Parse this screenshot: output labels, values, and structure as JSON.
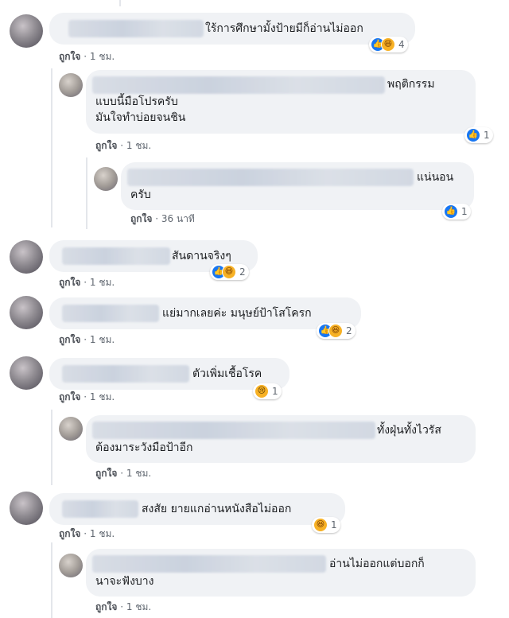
{
  "comments": [
    {
      "text": "ใร้การศึกษามั้งป้ายมีก็อ่านไม่ออก",
      "like": "ถูกใจ",
      "dot": "·",
      "time": "1 ชม.",
      "reaction_count": "4",
      "reactions": [
        "like-icon",
        "haha-icon"
      ]
    },
    {
      "text_lines": [
        "พฤติกรรม",
        "แบบนี้มือโปรครับ",
        "มันใจทำบ่อยจนชิน"
      ],
      "like": "ถูกใจ",
      "dot": "·",
      "time": "1 ชม.",
      "reaction_count": "1",
      "reactions": [
        "like-icon"
      ]
    },
    {
      "text_lines": [
        "แน่นอน",
        "ครับ"
      ],
      "like": "ถูกใจ",
      "dot": "·",
      "time": "36 นาที",
      "reaction_count": "1",
      "reactions": [
        "like-icon"
      ]
    },
    {
      "text": "สันดานจริงๆ",
      "like": "ถูกใจ",
      "dot": "·",
      "time": "1 ชม.",
      "reaction_count": "2",
      "reactions": [
        "like-icon",
        "haha-icon"
      ]
    },
    {
      "text": "แย่มากเลยค่ะ มนุษย์ป้าโสโครก",
      "like": "ถูกใจ",
      "dot": "·",
      "time": "1 ชม.",
      "reaction_count": "2",
      "reactions": [
        "like-icon",
        "haha-icon"
      ]
    },
    {
      "text": "ตัวเพิ่มเชื้อโรค",
      "like": "ถูกใจ",
      "dot": "·",
      "time": "1 ชม.",
      "reaction_count": "1",
      "reactions": [
        "sad-icon"
      ]
    },
    {
      "text_lines": [
        "ทั้งฝุ่นทั้งไวรัส",
        "ต้องมาระวังมือป้าอีก"
      ],
      "like": "ถูกใจ",
      "dot": "·",
      "time": "1 ชม."
    },
    {
      "text": "สงสัย ยายแกอ่านหนังสือไม่ออก",
      "like": "ถูกใจ",
      "dot": "·",
      "time": "1 ชม.",
      "reaction_count": "1",
      "reactions": [
        "haha-icon"
      ]
    },
    {
      "text_lines": [
        "อ่านไม่ออกแต่บอกก็",
        "นาจะฟังบาง"
      ],
      "like": "ถูกใจ",
      "dot": "·",
      "time": "1 ชม."
    }
  ],
  "colors": {
    "like_blue": "#1877f2",
    "haha_yellow": "#f7b125",
    "bubble_bg": "#f0f2f5",
    "meta_gray": "#606770"
  }
}
